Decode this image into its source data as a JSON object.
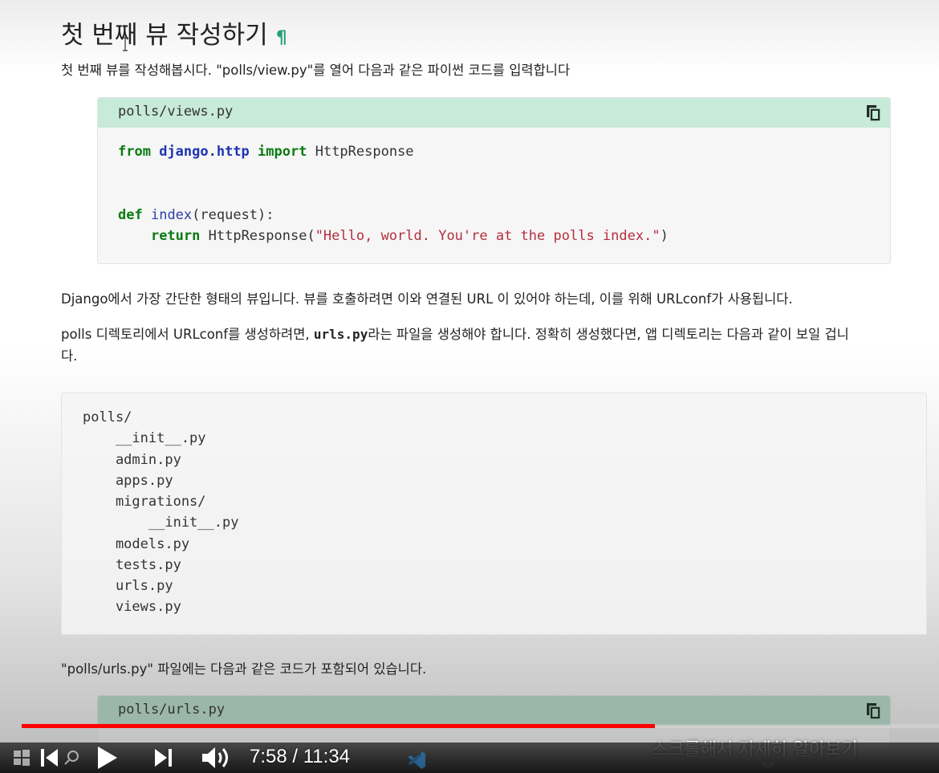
{
  "section": {
    "heading": "첫 번째 뷰 작성하기",
    "anchor": "¶",
    "intro": "첫 번째 뷰를 작성해봅시다. \"polls/view.py\"를 열어 다음과 같은 파이썬 코드를 입력합니다"
  },
  "code1": {
    "filename": "polls/views.py",
    "line1": {
      "kw_from": "from",
      "module": "django.http",
      "kw_import": "import",
      "name": "HttpResponse"
    },
    "line2": {
      "kw_def": "def",
      "fn": "index",
      "args": "(request):"
    },
    "line3": {
      "kw_return": "return",
      "call": "HttpResponse(",
      "string": "\"Hello, world. You're at the polls index.\"",
      "close": ")"
    }
  },
  "para2": "Django에서 가장 간단한 형태의 뷰입니다. 뷰를 호출하려면 이와 연결된 URL 이 있어야 하는데, 이를 위해 URLconf가 사용됩니다.",
  "para3": {
    "before": "polls 디렉토리에서 URLconf를 생성하려면, ",
    "code": "urls.py",
    "after": "라는 파일을 생성해야 합니다. 정확히 생성했다면, 앱 디렉토리는 다음과 같이 보일 겁니",
    "wrap": "다."
  },
  "tree": [
    "polls/",
    "    __init__.py",
    "    admin.py",
    "    apps.py",
    "    migrations/",
    "        __init__.py",
    "    models.py",
    "    tests.py",
    "    urls.py",
    "    views.py"
  ],
  "para4": "\"polls/urls.py\" 파일에는 다음과 같은 코드가 포함되어 있습니다.",
  "code2": {
    "filename": "polls/urls.py"
  },
  "player": {
    "current_time": "7:58",
    "separator": " / ",
    "duration": "11:34",
    "progress_fraction": 0.69,
    "scroll_hint": "스크롤해서 자세히 알아보기",
    "accent_color": "#ff0000"
  },
  "colors": {
    "filebar": "#c7ead9",
    "keyword": "#0a7b12",
    "string": "#b3303d",
    "anchor": "#2aa17a"
  },
  "icons": [
    "ibeam-cursor-icon",
    "copy-icon",
    "windows-start-icon",
    "search-icon",
    "prev-icon",
    "play-icon",
    "next-icon",
    "volume-icon",
    "chevron-down-icon",
    "vscode-icon"
  ]
}
